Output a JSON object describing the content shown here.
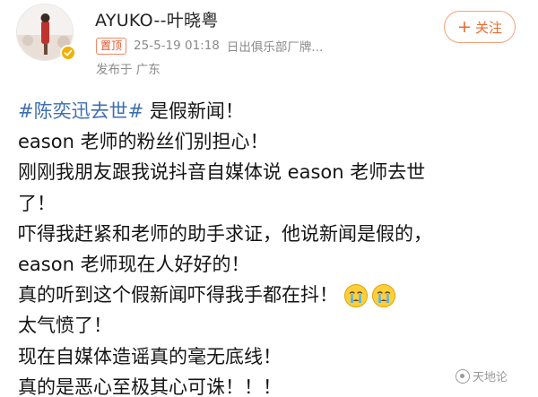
{
  "user": {
    "name": "AYUKO--叶晓粤",
    "avatar_icon": "avatar-photo-icon",
    "verified_icon": "verified-badge-icon",
    "verified_color": "#f2b100"
  },
  "follow": {
    "icon": "+",
    "label": "关注",
    "color": "#ea6a2c"
  },
  "meta": {
    "pinned": "置顶",
    "time": "25-5-19 01:18",
    "source": "日出俱乐部厂牌...",
    "location": "发布于 广东"
  },
  "post": {
    "hashtag": "#陈奕迅去世#",
    "hashtag_color": "#3d6fb0",
    "line1_rest": " 是假新闻！",
    "lines": [
      "eason 老师的粉丝们别担心！",
      "刚刚我朋友跟我说抖音自媒体说 eason 老师去世",
      "了！",
      "吓得我赶紧和老师的助手求证，他说新闻是假的，",
      "eason 老师现在人好好的！"
    ],
    "line_emoji": "真的听到这个假新闻吓得我手都在抖！",
    "emojis": [
      "crying-face-icon",
      "crying-face-icon"
    ],
    "lines_after": [
      "太气愤了！",
      "现在自媒体造谣真的毫无底线！",
      "真的是恶心至极其心可诛！！！"
    ]
  },
  "watermark": {
    "text": "天地论"
  }
}
